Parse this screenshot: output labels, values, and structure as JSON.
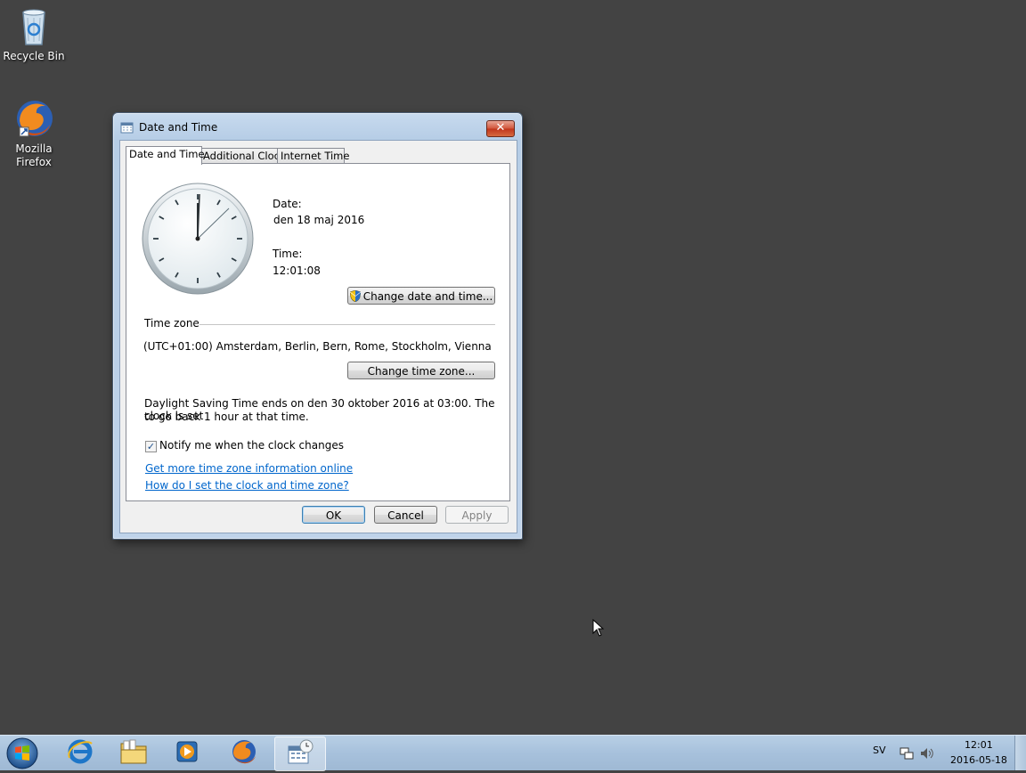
{
  "desktop": {
    "icons": [
      {
        "label": "Recycle Bin",
        "icon": "recycle-bin-icon"
      },
      {
        "label": "Mozilla Firefox",
        "icon": "firefox-icon"
      }
    ]
  },
  "window": {
    "title": "Date and Time",
    "close_label": "✕",
    "tabs": [
      {
        "label": "Date and Time",
        "active": true
      },
      {
        "label": "Additional Clocks",
        "active": false
      },
      {
        "label": "Internet Time",
        "active": false
      }
    ],
    "date_label": "Date:",
    "date_value": "den 18 maj 2016",
    "time_label": "Time:",
    "time_value": "12:01:08",
    "change_datetime_button": "Change date and time...",
    "timezone_heading": "Time zone",
    "timezone_value": "(UTC+01:00) Amsterdam, Berlin, Bern, Rome, Stockholm, Vienna",
    "change_timezone_button": "Change time zone...",
    "dst_text_line1": "Daylight Saving Time ends on den 30 oktober 2016 at 03:00. The clock is set",
    "dst_text_line2": "to go back 1 hour at that time.",
    "notify_checkbox_label": "Notify me when the clock changes",
    "notify_checked": true,
    "link_more_info": "Get more time zone information online",
    "link_how_to": "How do I set the clock and time zone?",
    "ok_button": "OK",
    "cancel_button": "Cancel",
    "apply_button": "Apply"
  },
  "taskbar": {
    "items": [
      {
        "icon": "internet-explorer-icon",
        "active": false
      },
      {
        "icon": "file-explorer-icon",
        "active": false
      },
      {
        "icon": "media-player-icon",
        "active": false
      },
      {
        "icon": "firefox-icon",
        "active": false
      },
      {
        "icon": "date-time-icon",
        "active": true
      }
    ],
    "language": "SV",
    "clock_time": "12:01",
    "clock_date": "2016-05-18"
  },
  "colors": {
    "desktop_background": "#434343",
    "window_frame": "#bfd3ea",
    "link": "#0066cc"
  }
}
